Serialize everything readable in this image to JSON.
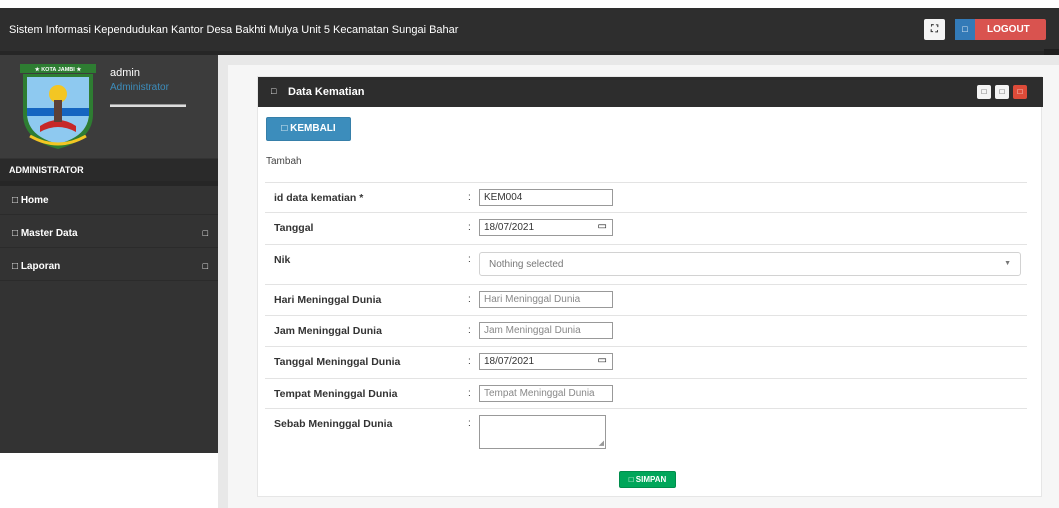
{
  "topbar": {
    "title": "Sistem Informasi Kependudukan Kantor Desa Bakhti Mulya Unit 5 Kecamatan Sungai Bahar",
    "fullscreen_icon": "⛶",
    "logout_icon": "□",
    "logout_label": "LOGOUT"
  },
  "sidebar": {
    "logo_caption": "★ KOTA JAMBI ★",
    "user_name": "admin",
    "user_role": "Administrator",
    "menu_header": "ADMINISTRATOR",
    "items": [
      {
        "label": "□ Home",
        "has_caret": false
      },
      {
        "label": "□ Master Data",
        "caret": "□"
      },
      {
        "label": "□ Laporan",
        "caret": "□"
      }
    ]
  },
  "box": {
    "header_icon": "□",
    "title": "Data Kematian",
    "tools": [
      "□",
      "□",
      "□"
    ],
    "kembali_label": "□ KEMBALI",
    "sub_label": "Tambah",
    "simpan_label": "□ SIMPAN"
  },
  "form": {
    "colon": ":",
    "rows": [
      {
        "label": "id data kematian *",
        "value": "KEM004"
      },
      {
        "label": "Tanggal",
        "value": "18/07/2021"
      },
      {
        "label": "Nik",
        "placeholder": "Nothing selected"
      },
      {
        "label": "Hari Meninggal Dunia",
        "placeholder": "Hari Meninggal Dunia"
      },
      {
        "label": "Jam Meninggal Dunia",
        "placeholder": "Jam Meninggal Dunia"
      },
      {
        "label": "Tanggal Meninggal Dunia",
        "value": "18/07/2021"
      },
      {
        "label": "Tempat Meninggal Dunia",
        "placeholder": "Tempat Meninggal Dunia"
      },
      {
        "label": "Sebab Meninggal Dunia",
        "value": ""
      }
    ]
  },
  "colors": {
    "topbar_bg": "#2e2e2e",
    "sidebar_bg": "#333333",
    "primary": "#3c8dbc",
    "danger": "#dd4b39",
    "success": "#00a65a"
  }
}
